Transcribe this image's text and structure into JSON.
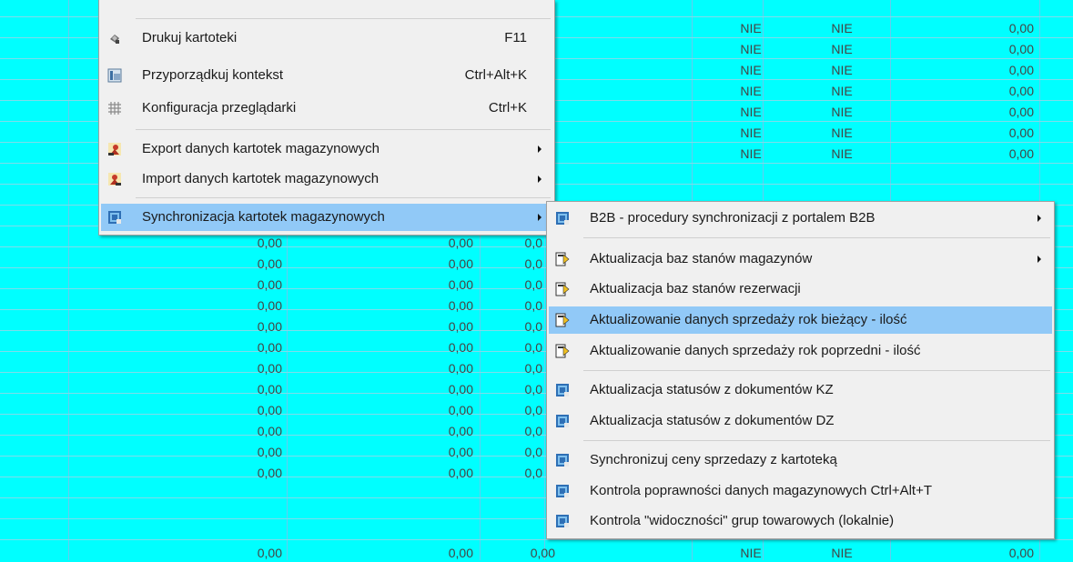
{
  "colors": {
    "grid_bg": "#00ffff",
    "menu_bg": "#f0f0f0",
    "highlight": "#91c9f7"
  },
  "grid": {
    "top_right_rows": [
      {
        "c1": "NIE",
        "c2": "NIE",
        "c3": "0,00"
      },
      {
        "c1": "NIE",
        "c2": "NIE",
        "c3": "0,00"
      },
      {
        "c1": "NIE",
        "c2": "NIE",
        "c3": "0,00"
      },
      {
        "c1": "NIE",
        "c2": "NIE",
        "c3": "0,00"
      },
      {
        "c1": "NIE",
        "c2": "NIE",
        "c3": "0,00"
      },
      {
        "c1": "NIE",
        "c2": "NIE",
        "c3": "0,00"
      },
      {
        "c1": "NIE",
        "c2": "NIE",
        "c3": "0,00"
      }
    ],
    "bottom_left_rows": [
      {
        "a": "0,00",
        "b": "0,00",
        "c": "0,0"
      },
      {
        "a": "0,00",
        "b": "0,00",
        "c": "0,0"
      },
      {
        "a": "0,00",
        "b": "0,00",
        "c": "0,0"
      },
      {
        "a": "0,00",
        "b": "0,00",
        "c": "0,0"
      },
      {
        "a": "0,00",
        "b": "0,00",
        "c": "0,0"
      },
      {
        "a": "0,00",
        "b": "0,00",
        "c": "0,0"
      },
      {
        "a": "0,00",
        "b": "0,00",
        "c": "0,0"
      },
      {
        "a": "0,00",
        "b": "0,00",
        "c": "0,0"
      },
      {
        "a": "0,00",
        "b": "0,00",
        "c": "0,0"
      },
      {
        "a": "0,00",
        "b": "0,00",
        "c": "0,0"
      },
      {
        "a": "0,00",
        "b": "0,00",
        "c": "0,0"
      },
      {
        "a": "0,00",
        "b": "0,00",
        "c": "0,0"
      }
    ],
    "last_row": {
      "a": "0,00",
      "b": "0,00",
      "c": "0,00",
      "d": "NIE",
      "e": "NIE",
      "f": "0,00"
    }
  },
  "main_menu": {
    "items": [
      {
        "label": "Drukuj kartoteki",
        "shortcut": "F11",
        "icon": "printer-icon"
      },
      {
        "label": "Przyporządkuj kontekst",
        "shortcut": "Ctrl+Alt+K",
        "icon": "context-icon"
      },
      {
        "label": "Konfiguracja przeglądarki",
        "shortcut": "Ctrl+K",
        "icon": "grid-config-icon"
      },
      {
        "label": "Export danych kartotek magazynowych",
        "shortcut": "",
        "icon": "export-icon"
      },
      {
        "label": "Import danych kartotek magazynowych",
        "shortcut": "",
        "icon": "import-icon"
      },
      {
        "label": "Synchronizacja kartotek magazynowych",
        "shortcut": "",
        "icon": "sync-icon"
      }
    ]
  },
  "sub_menu": {
    "items": [
      {
        "label": "B2B - procedury synchronizacji z portalem B2B",
        "icon": "sync-icon"
      },
      {
        "label": "Aktualizacja baz stanów magazynów",
        "icon": "update-icon"
      },
      {
        "label": "Aktualizacja baz stanów rezerwacji",
        "icon": "update-icon"
      },
      {
        "label": "Aktualizowanie danych sprzedaży rok bieżący - ilość",
        "icon": "update-icon"
      },
      {
        "label": "Aktualizowanie danych sprzedaży rok poprzedni - ilość",
        "icon": "update-icon"
      },
      {
        "label": "Aktualizacja statusów z dokumentów KZ",
        "icon": "sync-icon"
      },
      {
        "label": "Aktualizacja statusów z dokumentów DZ",
        "icon": "sync-icon"
      },
      {
        "label": "Synchronizuj ceny sprzedazy z kartoteką",
        "icon": "sync-icon"
      },
      {
        "label": "Kontrola poprawności danych magazynowych Ctrl+Alt+T",
        "icon": "sync-icon"
      },
      {
        "label": "Kontrola \"widoczności\" grup towarowych (lokalnie)",
        "icon": "sync-icon"
      }
    ]
  }
}
